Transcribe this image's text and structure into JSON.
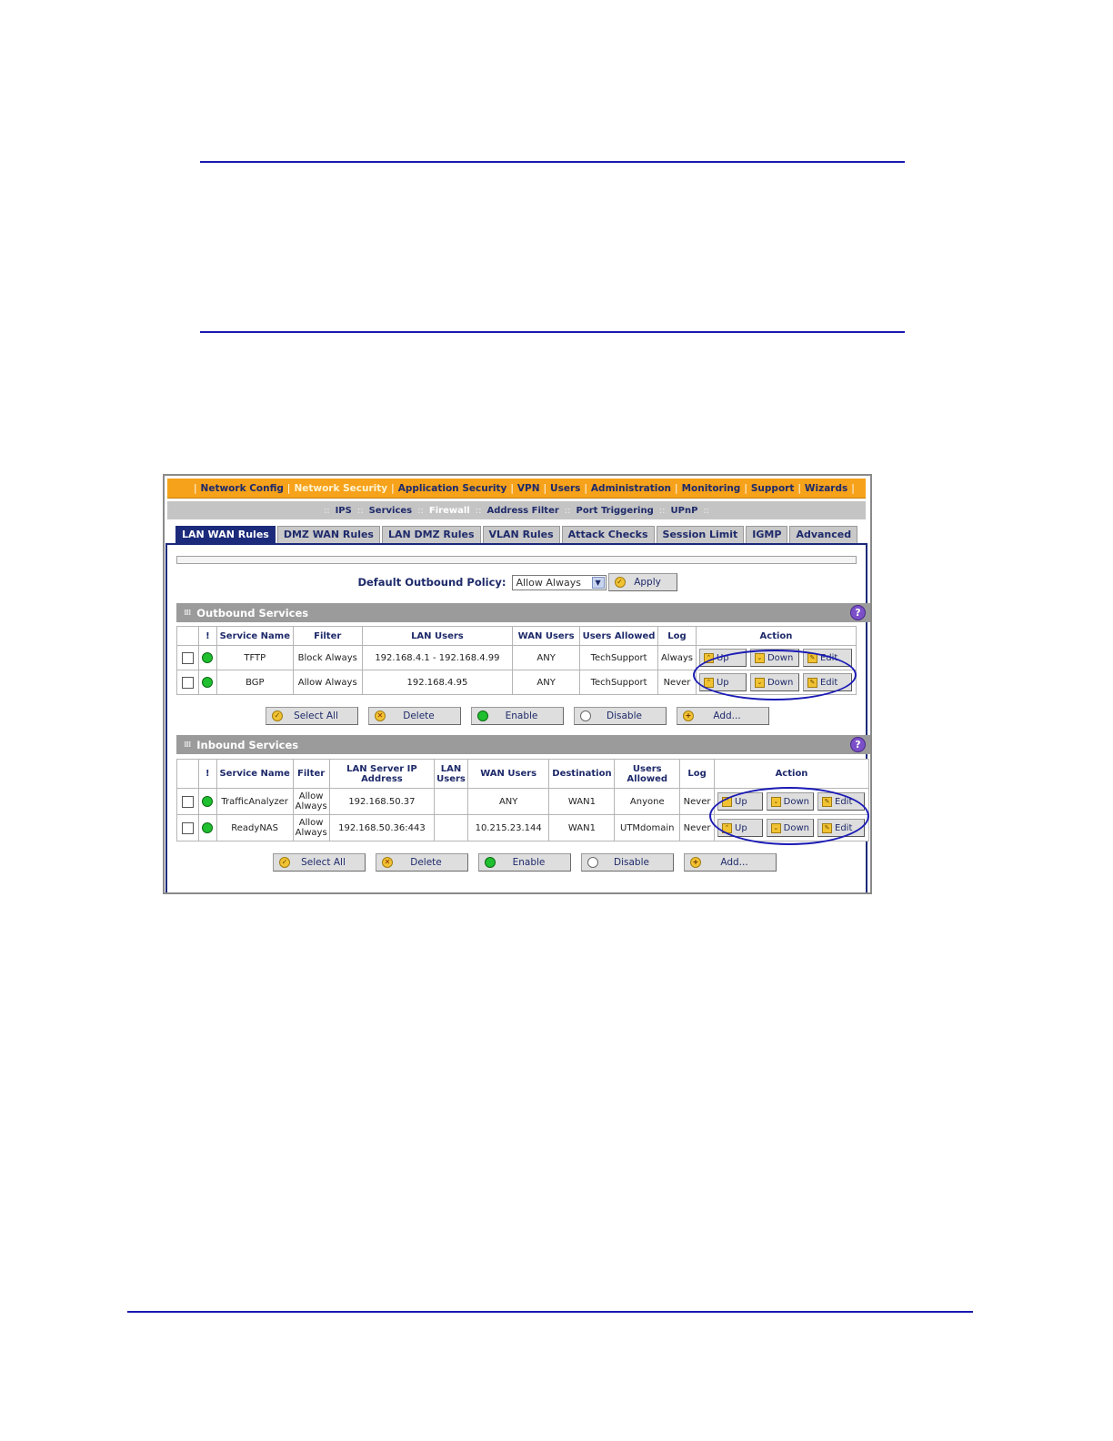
{
  "nav": {
    "items": [
      "Network Config",
      "Network Security",
      "Application Security",
      "VPN",
      "Users",
      "Administration",
      "Monitoring",
      "Support",
      "Wizards"
    ],
    "active": "Network Security"
  },
  "subnav": {
    "items": [
      "IPS",
      "Services",
      "Firewall",
      "Address Filter",
      "Port Triggering",
      "UPnP"
    ],
    "active": "Firewall"
  },
  "tabs": {
    "items": [
      "LAN WAN Rules",
      "DMZ WAN Rules",
      "LAN DMZ Rules",
      "VLAN Rules",
      "Attack Checks",
      "Session Limit",
      "IGMP",
      "Advanced"
    ],
    "active": "LAN WAN Rules"
  },
  "policy": {
    "label": "Default Outbound Policy:",
    "selected": "Allow Always",
    "apply_label": "Apply"
  },
  "outbound": {
    "title": "Outbound Services",
    "headers": [
      "!",
      "Service Name",
      "Filter",
      "LAN Users",
      "WAN Users",
      "Users Allowed",
      "Log",
      "Action"
    ],
    "rows": [
      {
        "service": "TFTP",
        "filter": "Block Always",
        "lan_users": "192.168.4.1 - 192.168.4.99",
        "wan_users": "ANY",
        "users_allowed": "TechSupport",
        "log": "Always"
      },
      {
        "service": "BGP",
        "filter": "Allow Always",
        "lan_users": "192.168.4.95",
        "wan_users": "ANY",
        "users_allowed": "TechSupport",
        "log": "Never"
      }
    ]
  },
  "inbound": {
    "title": "Inbound Services",
    "headers": [
      "!",
      "Service Name",
      "Filter",
      "LAN Server IP Address",
      "LAN Users",
      "WAN Users",
      "Destination",
      "Users Allowed",
      "Log",
      "Action"
    ],
    "rows": [
      {
        "service": "TrafficAnalyzer",
        "filter": "Allow Always",
        "server_ip": "192.168.50.37",
        "lan_users": "",
        "wan_users": "ANY",
        "destination": "WAN1",
        "users_allowed": "Anyone",
        "log": "Never"
      },
      {
        "service": "ReadyNAS",
        "filter": "Allow Always",
        "server_ip": "192.168.50.36:443",
        "lan_users": "",
        "wan_users": "10.215.23.144",
        "destination": "WAN1",
        "users_allowed": "UTMdomain",
        "log": "Never"
      }
    ]
  },
  "row_actions": {
    "up": "Up",
    "down": "Down",
    "edit": "Edit"
  },
  "table_buttons": {
    "select_all": "Select All",
    "delete": "Delete",
    "enable": "Enable",
    "disable": "Disable",
    "add": "Add..."
  },
  "colors": {
    "nav_bg": "#f6a21a",
    "tab_active": "#1b2a7a",
    "section_head": "#9b9b9b",
    "rule_line": "#1a1ab0",
    "highlight_oval": "#1b1bb5"
  }
}
